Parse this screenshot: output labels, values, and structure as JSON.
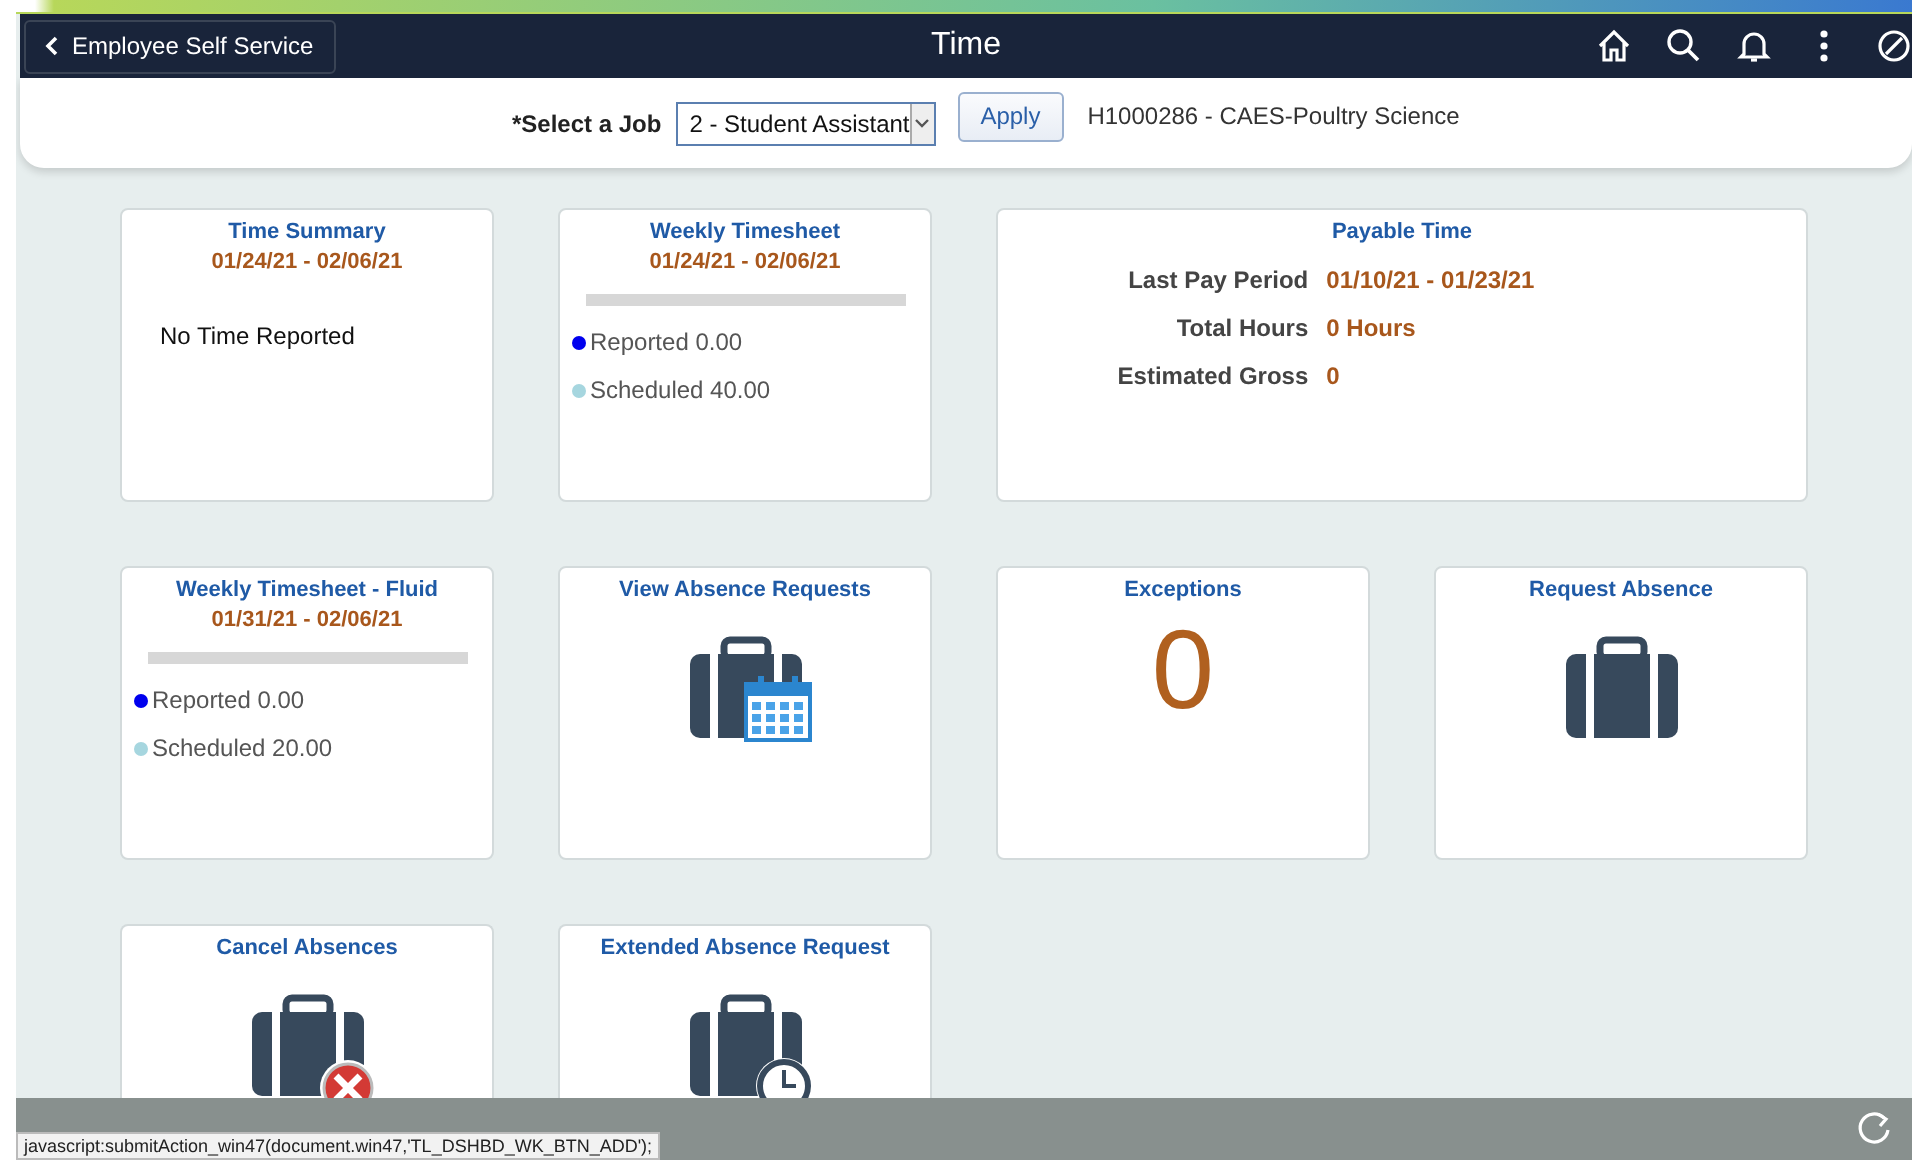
{
  "header": {
    "back_button": "Employee Self Service",
    "title": "Time"
  },
  "job_bar": {
    "label": "*Select a Job",
    "select_value": "2 - Student Assistant",
    "apply_button": "Apply",
    "job_info": "H1000286 - CAES-Poultry Science"
  },
  "tiles": [
    {
      "kind": "summary",
      "title": "Time Summary",
      "dates": "01/24/21 - 02/06/21",
      "message": "No Time Reported"
    },
    {
      "kind": "timesheet",
      "title": "Weekly Timesheet",
      "dates": "01/24/21 - 02/06/21",
      "legend": [
        {
          "label": "Reported 0.00",
          "color": "#0000ee"
        },
        {
          "label": "Scheduled 40.00",
          "color": "#a6d6df"
        }
      ]
    },
    {
      "kind": "payable",
      "title": "Payable Time",
      "rows": [
        {
          "label": "Last Pay Period",
          "value": "01/10/21 - 01/23/21"
        },
        {
          "label": "Total Hours",
          "value": "0 Hours"
        },
        {
          "label": "Estimated Gross",
          "value": "0"
        }
      ]
    },
    {
      "kind": "timesheet",
      "title": "Weekly Timesheet - Fluid",
      "dates": "01/31/21 - 02/06/21",
      "legend": [
        {
          "label": "Reported 0.00",
          "color": "#0000ee"
        },
        {
          "label": "Scheduled 20.00",
          "color": "#a6d6df"
        }
      ]
    },
    {
      "kind": "briefcase_calendar",
      "title": "View Absence Requests"
    },
    {
      "kind": "count",
      "title": "Exceptions",
      "count": "0"
    },
    {
      "kind": "briefcase",
      "title": "Request Absence"
    },
    {
      "kind": "briefcase_cancel",
      "title": "Cancel Absences"
    },
    {
      "kind": "briefcase_clock",
      "title": "Extended Absence Request"
    }
  ],
  "status_bar": {
    "link_text": "javascript:submitAction_win47(document.win47,'TL_DSHBD_WK_BTN_ADD');"
  }
}
